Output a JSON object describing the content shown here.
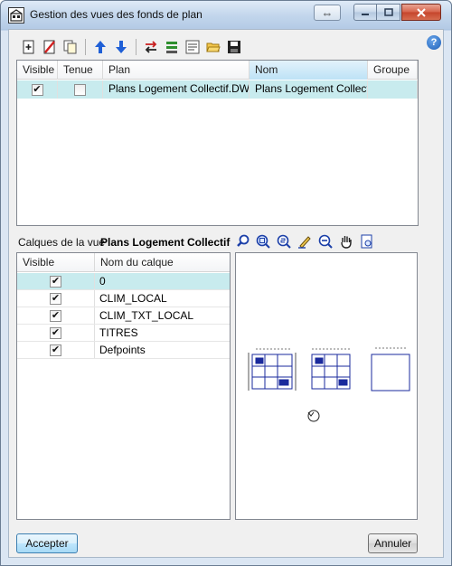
{
  "window": {
    "title": "Gestion des vues des fonds de plan"
  },
  "toolbar": {
    "buttons": [
      "new-icon",
      "delete-icon",
      "copy-icon",
      "move-up-icon",
      "move-down-icon",
      "swap-icon",
      "layers-icon",
      "dxf-icon",
      "open-folder-icon",
      "save-icon"
    ]
  },
  "plans_table": {
    "headers": {
      "visible": "Visible",
      "tenue": "Tenue",
      "plan": "Plan",
      "nom": "Nom",
      "groupe": "Groupe"
    },
    "rows": [
      {
        "visible": true,
        "tenue": false,
        "plan": "Plans Logement Collectif.DWG",
        "nom": "Plans Logement Collectif",
        "groupe": ""
      }
    ]
  },
  "layers": {
    "label": "Calques de la vue",
    "view_name": "Plans Logement Collectif",
    "headers": {
      "visible": "Visible",
      "name": "Nom du calque"
    },
    "rows": [
      {
        "visible": true,
        "name": "0"
      },
      {
        "visible": true,
        "name": "CLIM_LOCAL"
      },
      {
        "visible": true,
        "name": "CLIM_TXT_LOCAL"
      },
      {
        "visible": true,
        "name": "TITRES"
      },
      {
        "visible": true,
        "name": "Defpoints"
      }
    ]
  },
  "viewer_tools": [
    "zoom-extents-icon",
    "zoom-window-icon",
    "zoom-2x-icon",
    "pencil-icon",
    "zoom-out-icon",
    "pan-hand-icon",
    "print-preview-icon"
  ],
  "footer": {
    "accept": "Accepter",
    "cancel": "Annuler"
  },
  "colors": {
    "selection": "#c8ebee",
    "plan_lines": "#1a2a9c"
  }
}
